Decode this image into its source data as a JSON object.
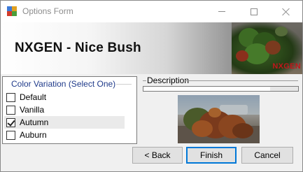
{
  "window": {
    "title": "Options Form",
    "icons": {
      "app": "app-window-icon",
      "minimize": "minimize-icon",
      "maximize": "maximize-icon",
      "close": "close-icon"
    }
  },
  "banner": {
    "title": "NXGEN - Nice Bush",
    "brand": "NXGEN",
    "colors": {
      "brand": "#c0161b"
    }
  },
  "color_variation": {
    "caption": "Color Variation (Select One)",
    "options": [
      {
        "label": "Default",
        "checked": false
      },
      {
        "label": "Vanilla",
        "checked": false
      },
      {
        "label": "Autumn",
        "checked": true
      },
      {
        "label": "Auburn",
        "checked": false
      }
    ]
  },
  "description": {
    "label": "Description"
  },
  "buttons": {
    "back": "< Back",
    "finish": "Finish",
    "cancel": "Cancel"
  }
}
